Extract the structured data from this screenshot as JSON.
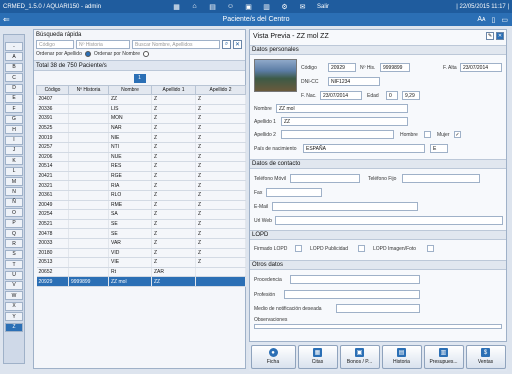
{
  "app": {
    "title": "CRMED_1.5.0 / AQUARI150 - admin",
    "salir": "Salir",
    "datetime": "| 22/05/2015 11:17 |",
    "screen_title": "Paciente/s del Centro"
  },
  "alphabet": [
    "-",
    "A",
    "B",
    "C",
    "D",
    "E",
    "F",
    "G",
    "H",
    "I",
    "J",
    "K",
    "L",
    "M",
    "N",
    "Ñ",
    "O",
    "P",
    "Q",
    "R",
    "S",
    "T",
    "U",
    "V",
    "W",
    "X",
    "Y",
    "Z"
  ],
  "alphabet_selected": "Z",
  "search": {
    "title": "Búsqueda rápida",
    "codigo_placeholder": "Código",
    "historia_placeholder": "Nº Historia",
    "nombre_placeholder": "Buscar Nombre, Apellidos",
    "order_apellido": "Ordenar por Apellido",
    "order_nombre": "Ordenar por Nombre"
  },
  "list": {
    "total": "Total 38 de 750 Paciente/s",
    "page": "1",
    "columns": [
      "Código",
      "Nº Historia",
      "Nombre",
      "Apellido 1",
      "Apellido 2"
    ],
    "rows": [
      [
        "20407",
        "",
        "ZZ",
        "Z",
        "Z"
      ],
      [
        "20336",
        "",
        "LIS",
        "Z",
        "Z"
      ],
      [
        "20391",
        "",
        "MON",
        "Z",
        "Z"
      ],
      [
        "20525",
        "",
        "NAR",
        "Z",
        "Z"
      ],
      [
        "20019",
        "",
        "NIE",
        "Z",
        "Z"
      ],
      [
        "20257",
        "",
        "NTI",
        "Z",
        "Z"
      ],
      [
        "20206",
        "",
        "NUE",
        "Z",
        "Z"
      ],
      [
        "20514",
        "",
        "RES",
        "Z",
        "Z"
      ],
      [
        "20421",
        "",
        "RGE",
        "Z",
        "Z"
      ],
      [
        "20321",
        "",
        "RIA",
        "Z",
        "Z"
      ],
      [
        "20361",
        "",
        "RLO",
        "Z",
        "Z"
      ],
      [
        "20049",
        "",
        "RME",
        "Z",
        "Z"
      ],
      [
        "20254",
        "",
        "SA",
        "Z",
        "Z"
      ],
      [
        "20521",
        "",
        "SE",
        "Z",
        "Z"
      ],
      [
        "20478",
        "",
        "SE",
        "Z",
        "Z"
      ],
      [
        "20033",
        "",
        "VAR",
        "Z",
        "Z"
      ],
      [
        "20180",
        "",
        "VID",
        "Z",
        "Z"
      ],
      [
        "20513",
        "",
        "VIE",
        "Z",
        "Z"
      ],
      [
        "20652",
        "",
        "Rt",
        "ZAR",
        ""
      ],
      [
        "20929",
        "9999899",
        "ZZ mol",
        "ZZ",
        ""
      ]
    ],
    "selected_index": 19
  },
  "detail": {
    "title": "Vista Previa - ZZ mol ZZ",
    "sections": {
      "personal": "Datos personales",
      "contact": "Datos de contacto",
      "lopd": "LOPD",
      "other": "Otros datos"
    },
    "labels": {
      "codigo": "Código",
      "historia": "Nº His.",
      "alta": "F. Alta",
      "dni": "DNI-CC",
      "fnac": "F. Nac.",
      "edad": "Edad",
      "nombre": "Nombre",
      "apellido1": "Apellido 1",
      "apellido2": "Apellido 2",
      "hombre": "Hombre",
      "mujer": "Mujer",
      "pais": "País de nacimiento",
      "movil": "Teléfono Móvil",
      "fijo": "Teléfono Fijo",
      "fax": "Fax",
      "email": "E-Mail",
      "web": "Url Web",
      "firmado": "Firmado LOPD",
      "publicidad": "LOPD Publicidad",
      "imagen": "LOPD Imagen/Foto",
      "procedencia": "Procedencia",
      "profesion": "Profesión",
      "medio": "Medio de notificación deseada",
      "observaciones": "Observaciones"
    },
    "values": {
      "codigo": "20929",
      "historia": "9999899",
      "alta": "23/07/2014",
      "dni": "NIF1234",
      "fnac": "23/07/2014",
      "edad_a": "0",
      "edad_b": "9,29",
      "nombre": "ZZ mol",
      "apellido1": "ZZ",
      "apellido2": "",
      "pais": "ESPAÑA",
      "pais_code": "E",
      "mujer_checked": "✓"
    }
  },
  "bottom_buttons": [
    "Ficha",
    "Citas",
    "Bonos / P...",
    "Historia",
    "Presupues...",
    "Ventas"
  ],
  "colors": {
    "topbar": "#1f5c9e",
    "accent": "#2b6fb5"
  }
}
